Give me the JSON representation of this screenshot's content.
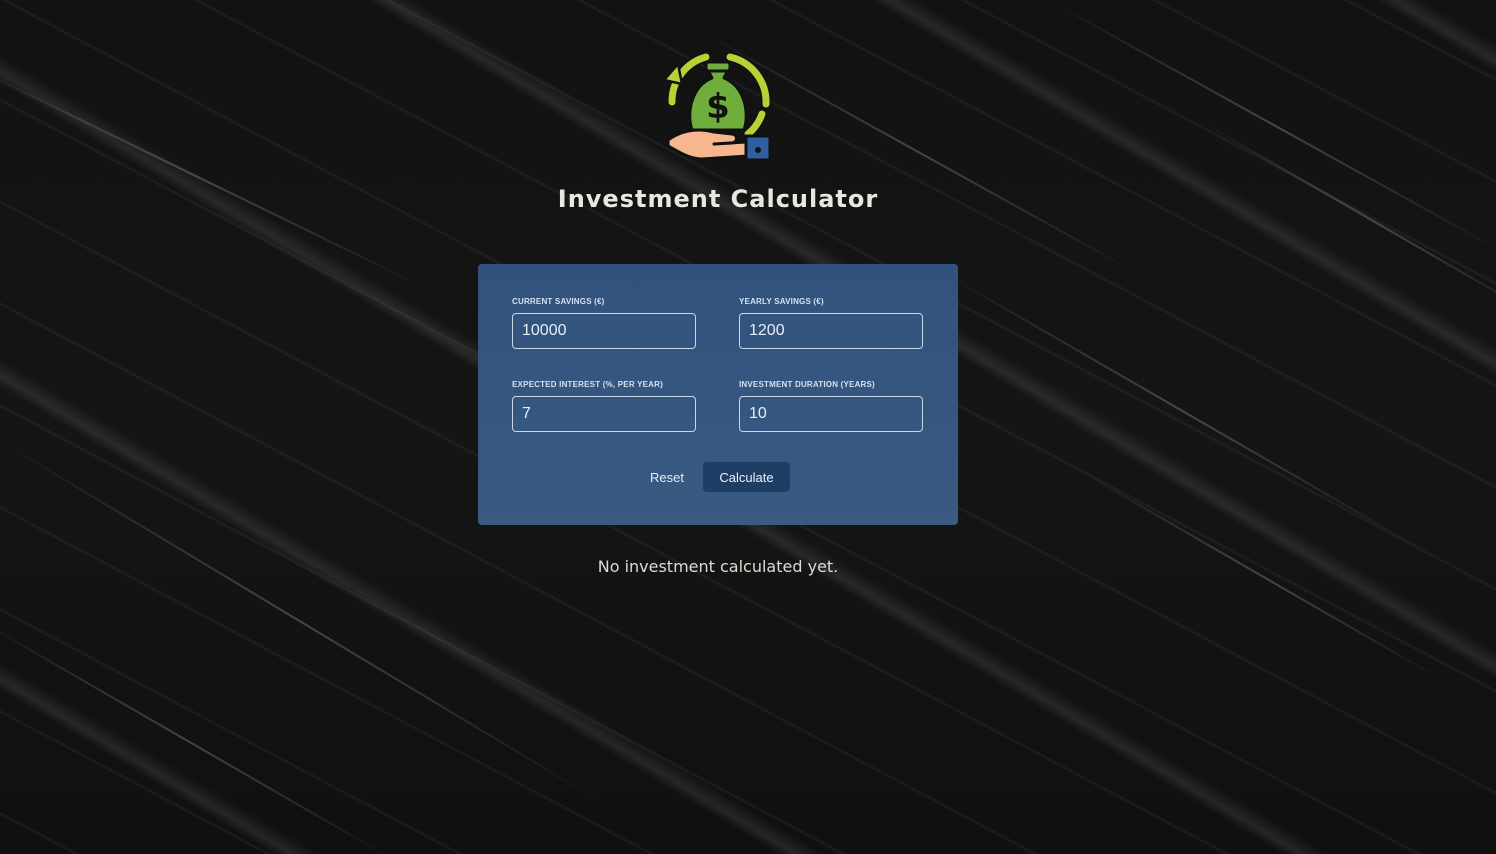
{
  "app": {
    "title": "Investment Calculator"
  },
  "logo": {
    "icon": "money-bag-hand-icon",
    "symbol": "$"
  },
  "form": {
    "current_savings": {
      "label": "CURRENT SAVINGS (€)",
      "value": "10000"
    },
    "yearly_savings": {
      "label": "YEARLY SAVINGS (€)",
      "value": "1200"
    },
    "expected_interest": {
      "label": "EXPECTED INTEREST (%, PER YEAR)",
      "value": "7"
    },
    "investment_duration": {
      "label": "INVESTMENT DURATION (YEARS)",
      "value": "10"
    },
    "reset_label": "Reset",
    "calculate_label": "Calculate"
  },
  "result": {
    "message": "No investment calculated yet."
  },
  "colors": {
    "card": "#30527d",
    "calculate_button": "#1f3e66",
    "logo_green": "#8cc63f",
    "logo_ring": "#b5d334"
  }
}
